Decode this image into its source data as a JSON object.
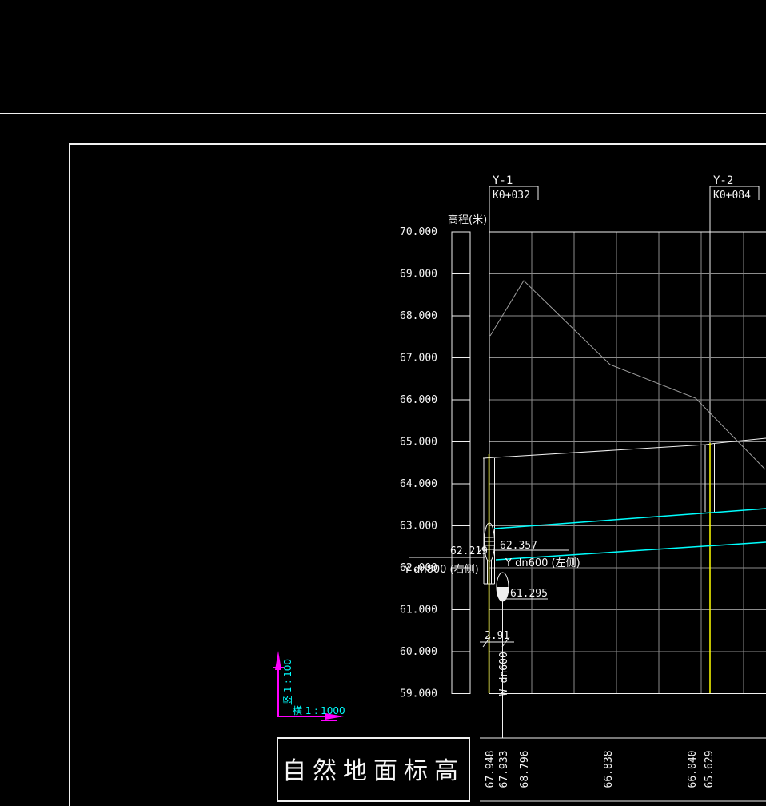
{
  "colors": {
    "background": "#000000",
    "line_white": "#f0f0f0",
    "text_white": "#f5f5f5",
    "grid_gray": "#8c8c8c",
    "terrain_gray": "#a0a0a0",
    "pipe_cyan": "#00ffff",
    "center_yellow": "#ffff00",
    "axis_magenta": "#ff00ff"
  },
  "stations": [
    {
      "name": "Y-1",
      "chainage": "K0+032"
    },
    {
      "name": "Y-2",
      "chainage": "K0+084"
    }
  ],
  "elevation_axis": {
    "label": "高程(米)",
    "ticks": [
      "70.000",
      "69.000",
      "68.000",
      "67.000",
      "66.000",
      "65.000",
      "64.000",
      "63.000",
      "62.000",
      "61.000",
      "60.000",
      "59.000"
    ]
  },
  "annotations": {
    "invert_dn800": "62.219",
    "invert_dn600": "62.357",
    "crossing_invert": "61.295",
    "offset_dim": "2.91",
    "pipe_dn800_label": "Y dn800 (右侧)",
    "pipe_dn600_label": "Y dn600 (左侧)",
    "crossing_pipe_label": "W dn600"
  },
  "scale_legend": {
    "vertical": "竖 1 : 100",
    "horizontal": "横 1 : 1000"
  },
  "table": {
    "header": "自然地面标高",
    "values": [
      "67.948",
      "67.933",
      "68.796",
      "66.838",
      "66.040",
      "65.629"
    ]
  },
  "chart_data": {
    "type": "line",
    "ylabel": "高程(米)",
    "ylim": [
      59,
      70
    ],
    "grid": true,
    "v_scale": "1:100",
    "h_scale": "1:1000",
    "stations": [
      {
        "name": "Y-1",
        "chainage": "K0+032"
      },
      {
        "name": "Y-2",
        "chainage": "K0+084"
      }
    ],
    "series": [
      {
        "name": "自然地面标高",
        "role": "natural-ground",
        "values": [
          67.948,
          67.933,
          68.796,
          66.838,
          66.04,
          65.629
        ]
      },
      {
        "name": "Y dn600 (左侧)",
        "role": "rain-pipe-left",
        "invert_at_y1": 62.357
      },
      {
        "name": "Y dn800 (右侧)",
        "role": "rain-pipe-right",
        "invert_at_y1": 62.219
      },
      {
        "name": "W dn600",
        "role": "crossing-sewer",
        "crossing_elevation": 61.295,
        "offset_from_manhole_m": 2.91
      }
    ]
  }
}
